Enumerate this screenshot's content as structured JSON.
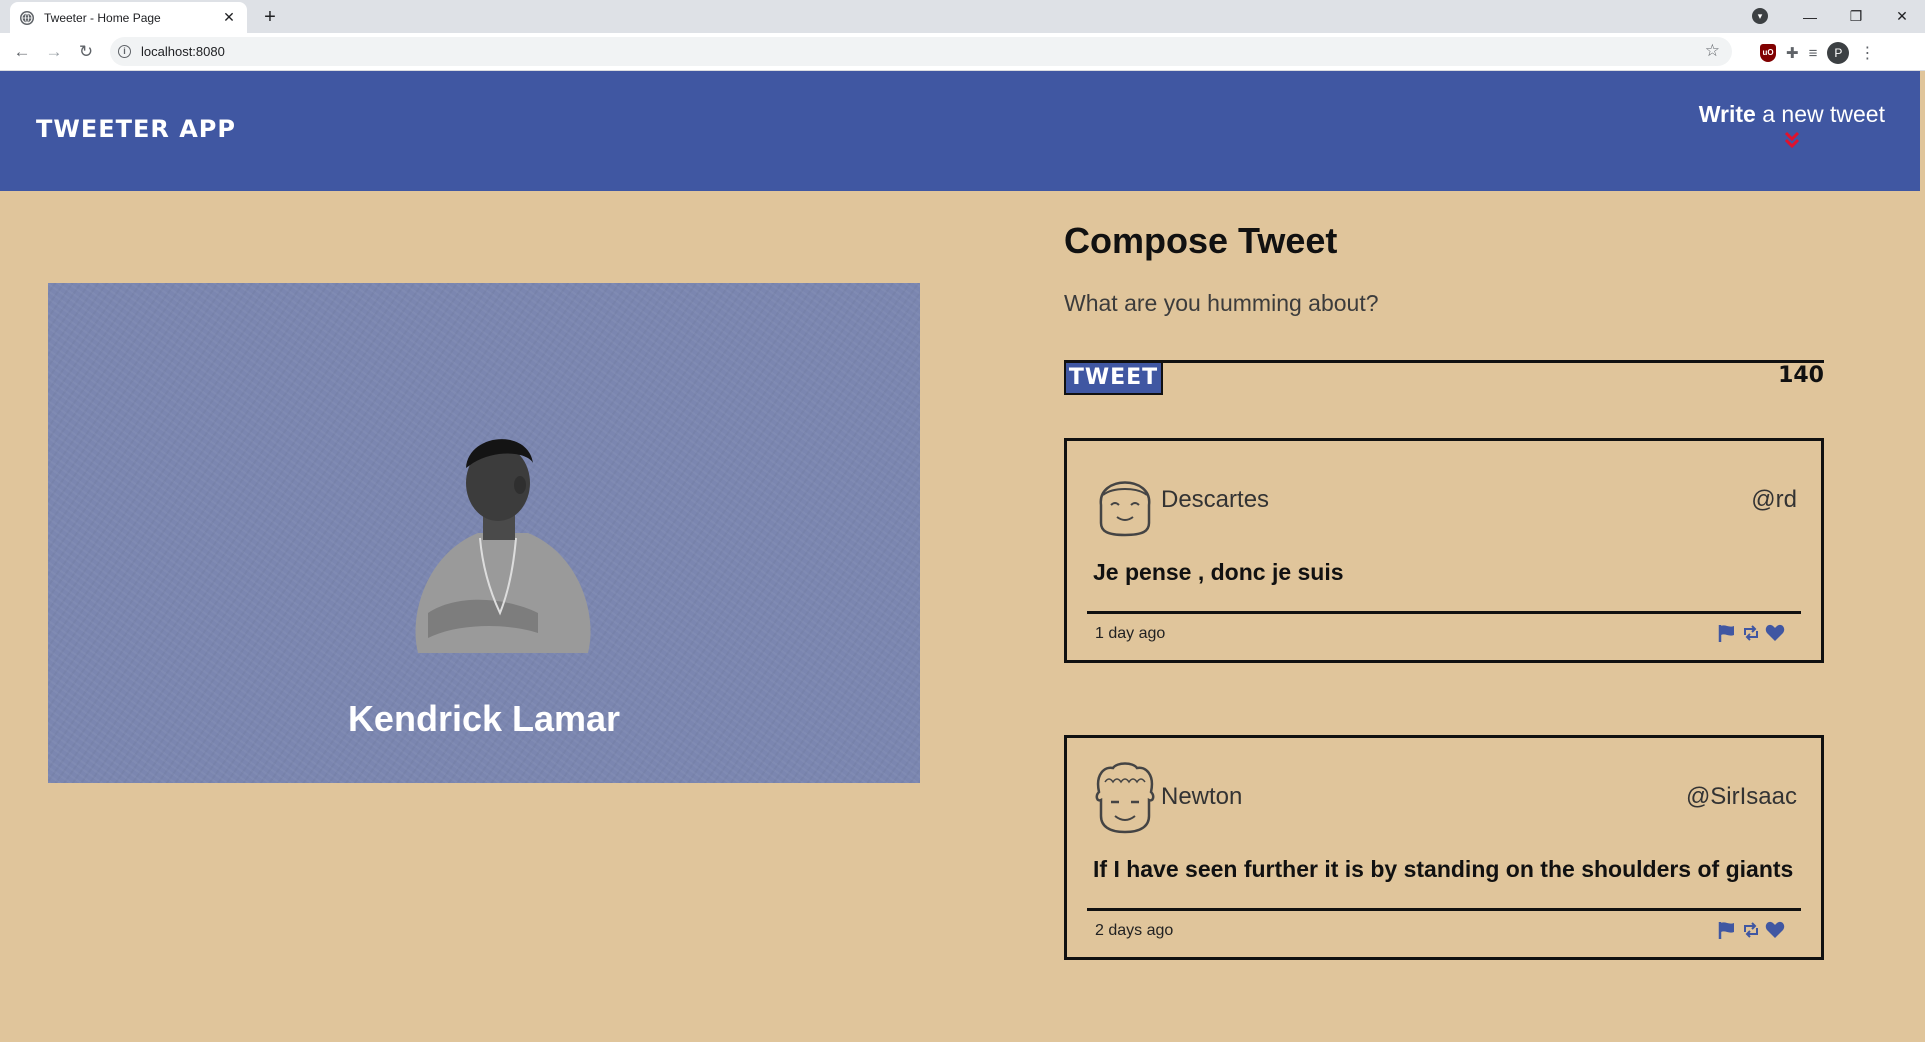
{
  "browser": {
    "tab_title": "Tweeter - Home Page",
    "tab_close": "✕",
    "new_tab": "+",
    "url": "localhost:8080",
    "profile_initial": "P"
  },
  "nav": {
    "logo": "TWEETER APP",
    "write_bold": "Write",
    "write_rest": "a new tweet"
  },
  "profile": {
    "name": "Kendrick Lamar"
  },
  "compose": {
    "title": "Compose Tweet",
    "placeholder": "What are you humming about?",
    "button": "TWEET",
    "counter": "140"
  },
  "tweets": [
    {
      "name": "Descartes",
      "handle": "@rd",
      "text": "Je pense , donc je suis",
      "time": "1 day ago"
    },
    {
      "name": "Newton",
      "handle": "@SirIsaac",
      "text": "If I have seen further it is by standing on the shoulders of giants",
      "time": "2 days ago"
    }
  ],
  "colors": {
    "nav_blue": "#4057a2",
    "page_bg": "#e0c59b",
    "card_bg": "#7b86b0",
    "accent_red": "#e0122d"
  }
}
